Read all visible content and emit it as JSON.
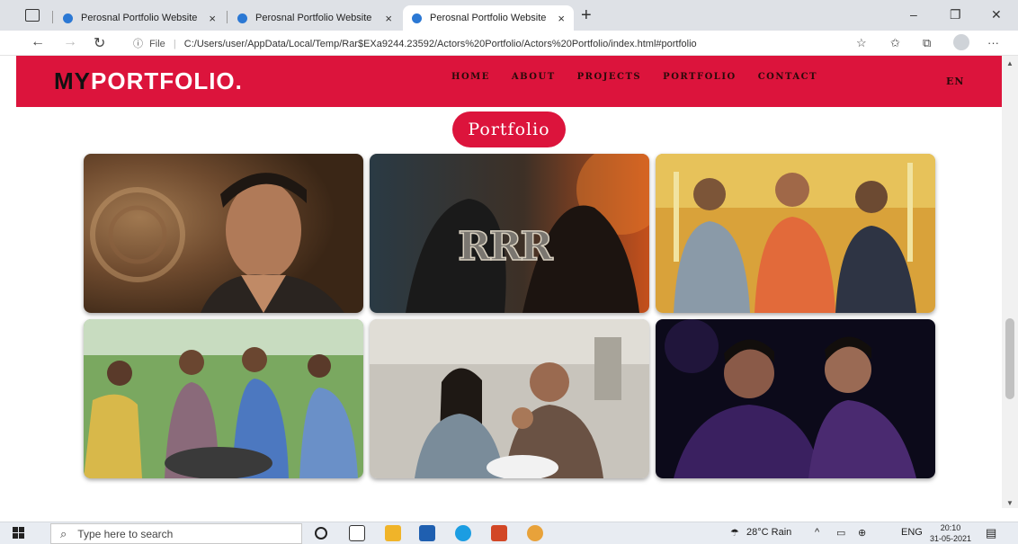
{
  "browser": {
    "tabs": [
      {
        "title": "Perosnal Portfolio Website"
      },
      {
        "title": "Perosnal Portfolio Website"
      },
      {
        "title": "Perosnal Portfolio Website",
        "active": true
      }
    ],
    "close_symbol": "×",
    "new_tab_symbol": "+",
    "window_controls": {
      "minimize": "–",
      "restore": "❐",
      "close": "✕"
    },
    "nav": {
      "back": "←",
      "forward": "→",
      "refresh": "↻"
    },
    "address": {
      "info_icon": "ⓘ",
      "scheme_label": "File",
      "url": "C:/Users/user/AppData/Local/Temp/Rar$EXa9244.23592/Actors%20Portfolio/Actors%20Portfolio/index.html#portfolio"
    },
    "toolbar_icons": [
      "favorite-add-icon",
      "favorites-icon",
      "collections-icon",
      "profile-icon",
      "more-icon"
    ],
    "toolbar_glyphs": {
      "favorite_add": "☆",
      "favorites": "✩",
      "collections": "⧉",
      "more": "···"
    }
  },
  "site": {
    "logo": {
      "prefix": "MY",
      "main": "PORTFOLIO."
    },
    "nav": [
      "HOME",
      "ABOUT",
      "PROJECTS",
      "PORTFOLIO",
      "CONTACT"
    ],
    "lang": "EN",
    "section_title": "Portfolio",
    "photos": [
      {
        "name": "portrait-photo"
      },
      {
        "name": "poster-photo"
      },
      {
        "name": "group-photo"
      },
      {
        "name": "crowd-photo"
      },
      {
        "name": "family-photo"
      },
      {
        "name": "friends-photo"
      }
    ],
    "colors": {
      "accent": "#dc143c",
      "logo_dark": "#111111"
    }
  },
  "taskbar": {
    "search_placeholder": "Type here to search",
    "search_icon": "⌕",
    "weather": "28°C  Rain",
    "tray_symbols": "^",
    "lang": "ENG",
    "time": "20:10",
    "date": "31-05-2021"
  }
}
